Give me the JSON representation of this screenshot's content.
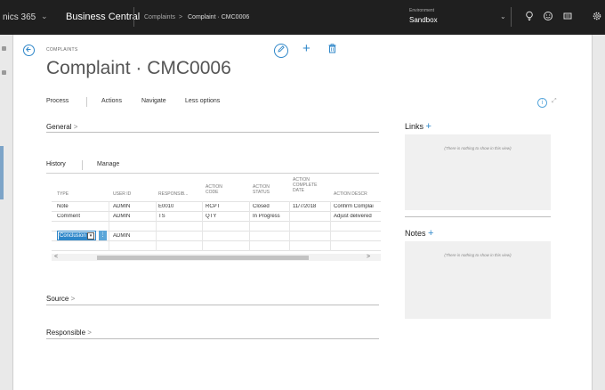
{
  "topbar": {
    "app_name": "nics 365",
    "app_chevron": "⌄",
    "product": "Business Central",
    "breadcrumb": [
      "Complaints",
      "Complaint · CMC0006"
    ],
    "breadcrumb_sep": ">",
    "environment_label": "Environment",
    "environment": "Sandbox",
    "environment_chevron": "⌄",
    "icons": [
      "lightbulb-icon",
      "smiley-icon",
      "assist-icon",
      "gear-icon"
    ]
  },
  "page": {
    "caption": "COMPLAINTS",
    "title": "Complaint · CMC0006",
    "actions": [
      "Process",
      "Actions",
      "Navigate",
      "Less options"
    ]
  },
  "sections": {
    "general": "General",
    "source": "Source",
    "responsible": "Responsible"
  },
  "history": {
    "tab": "History",
    "manage": "Manage",
    "columns": [
      "TYPE",
      "USER ID",
      "RESPONSIB...",
      "ACTION CODE",
      "ACTION STATUS",
      "ACTION COMPLETE DATE",
      "ACTION DESCR"
    ],
    "rows": [
      [
        "Note",
        "ADMIN",
        "E0010",
        "RCPT",
        "Closed",
        "11/7/2018",
        "Confirm Complai"
      ],
      [
        "Comment",
        "ADMIN",
        "TS",
        "QTY",
        "In Progress",
        "",
        "Adjust delivered"
      ],
      [
        "Conclusion",
        "ADMIN",
        "",
        "",
        "",
        "",
        ""
      ]
    ],
    "row_menu": "⋮",
    "scroll_left": "<",
    "scroll_right": ">"
  },
  "factboxes": {
    "links_title": "Links",
    "notes_title": "Notes",
    "plus": "+",
    "empty_text": "(There is nothing to show in this view)"
  }
}
